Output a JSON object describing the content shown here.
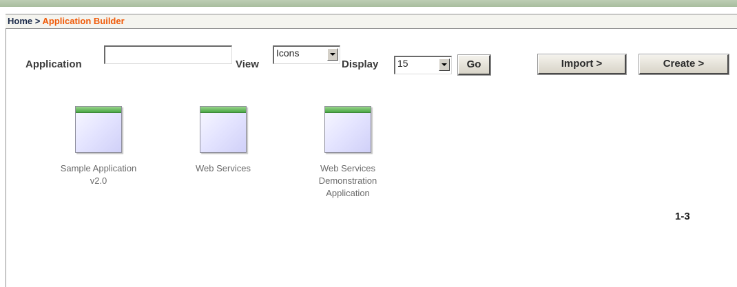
{
  "breadcrumb": {
    "home": "Home",
    "separator": ">",
    "current": "Application Builder"
  },
  "filters": {
    "application_label": "Application",
    "application_value": "",
    "view_label": "View",
    "view_value": "Icons",
    "display_label": "Display",
    "display_value": "15",
    "go_label": "Go"
  },
  "actions": {
    "import_label": "Import >",
    "create_label": "Create >"
  },
  "applications": [
    {
      "name_line1": "Sample Application",
      "name_line2": "v2.0",
      "name_line3": ""
    },
    {
      "name_line1": "Web Services",
      "name_line2": "",
      "name_line3": ""
    },
    {
      "name_line1": "Web Services",
      "name_line2": "Demonstration",
      "name_line3": "Application"
    }
  ],
  "pagination": "1-3",
  "colors": {
    "breadcrumb_current": "#f05a08",
    "icon_header": "#4aa846",
    "icon_body": "#e4e4ff"
  }
}
